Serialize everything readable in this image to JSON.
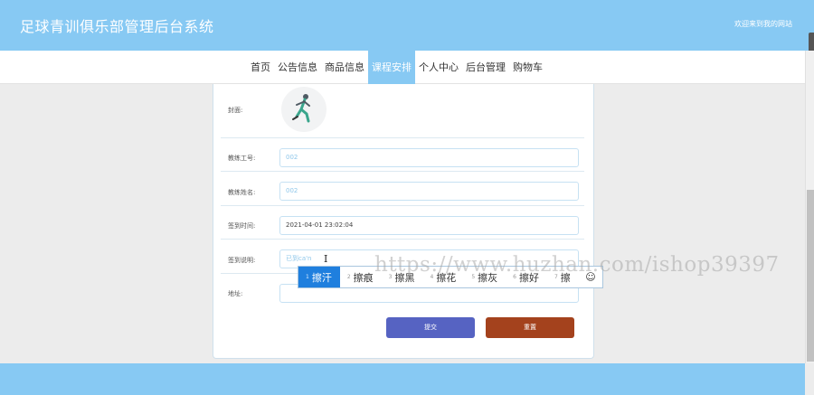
{
  "header": {
    "title": "足球青训俱乐部管理后台系统",
    "welcome": "欢迎来到我的网站"
  },
  "nav": {
    "items": [
      {
        "label": "首页",
        "active": false
      },
      {
        "label": "公告信息",
        "active": false
      },
      {
        "label": "商品信息",
        "active": false
      },
      {
        "label": "课程安排",
        "active": true
      },
      {
        "label": "个人中心",
        "active": false
      },
      {
        "label": "后台管理",
        "active": false
      },
      {
        "label": "购物车",
        "active": false
      }
    ]
  },
  "form": {
    "cover_label": "封面:",
    "coach_id_label": "教练工号:",
    "coach_id_value": "002",
    "coach_name_label": "教练姓名:",
    "coach_name_value": "002",
    "checkin_time_label": "签到时间:",
    "checkin_time_value": "2021-04-01 23:02:04",
    "checkin_note_label": "签到说明:",
    "checkin_note_value": "已到ca'n",
    "address_label": "地址:",
    "address_value": "",
    "submit_label": "提交",
    "reset_label": "重置"
  },
  "ime": {
    "candidates": [
      {
        "num": "1",
        "text": "擦汗"
      },
      {
        "num": "2",
        "text": "擦痕"
      },
      {
        "num": "3",
        "text": "擦黑"
      },
      {
        "num": "4",
        "text": "擦花"
      },
      {
        "num": "5",
        "text": "擦灰"
      },
      {
        "num": "6",
        "text": "擦好"
      },
      {
        "num": "7",
        "text": "擦"
      }
    ],
    "settings_icon": "☺"
  },
  "watermark": "https://www.huzhan.com/ishop39397",
  "colors": {
    "header": "#87c9f3",
    "active_nav": "#87c9f3",
    "submit": "#5663c2",
    "reset": "#a4421d",
    "ime_selected": "#1f7fde"
  }
}
